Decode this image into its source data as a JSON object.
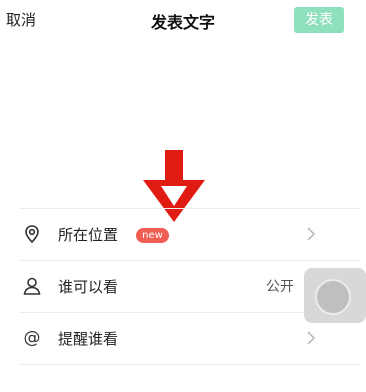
{
  "header": {
    "cancel_label": "取消",
    "title": "发表文字",
    "publish_label": "发表"
  },
  "settings": {
    "location": {
      "label": "所在位置",
      "badge": "new",
      "icon": "location-pin-icon"
    },
    "visibility": {
      "label": "谁可以看",
      "value": "公开",
      "icon": "person-icon"
    },
    "mention": {
      "label": "提醒谁看",
      "icon": "at-icon"
    }
  },
  "colors": {
    "publish_bg": "#8fe0bd",
    "badge_bg": "#ef5d53",
    "arrow": "#e01b12"
  }
}
